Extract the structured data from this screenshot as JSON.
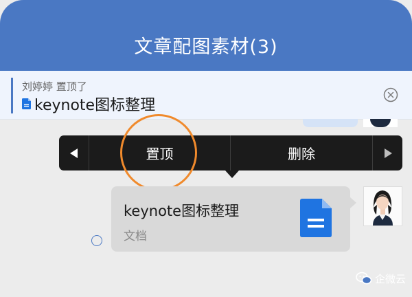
{
  "header": {
    "title": "文章配图素材(3)"
  },
  "pinned": {
    "who": "刘婷婷   置顶了",
    "doc_name": "keynote图标整理"
  },
  "context_menu": {
    "pin_label": "置顶",
    "delete_label": "删除"
  },
  "message": {
    "file_name": "keynote图标整理",
    "file_type": "文档"
  },
  "watermark": {
    "text": "企微云"
  },
  "colors": {
    "header": "#4a78c3",
    "highlight_circle": "#f08a2c",
    "doc_icon": "#1f74e1"
  }
}
